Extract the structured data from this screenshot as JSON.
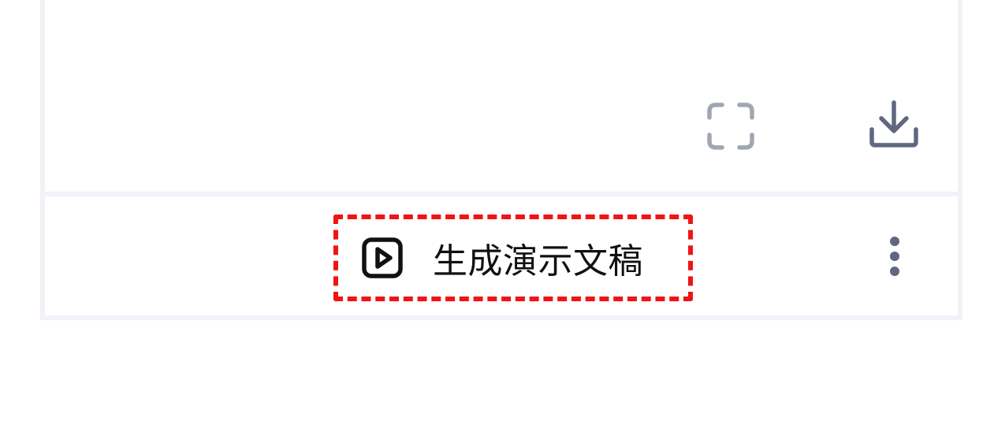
{
  "toolbar": {
    "fullscreen_icon": "fullscreen-icon",
    "download_icon": "download-icon"
  },
  "actions": {
    "generate_label": "生成演示文稿",
    "generate_icon": "play-square-icon",
    "more_icon": "more-vertical-icon"
  },
  "colors": {
    "frame": "#f1f2f7",
    "fullscreen_icon": "#a0a6b4",
    "download_icon": "#5f6880",
    "more_icon": "#5f6880",
    "highlight_dash": "#f01414",
    "label_text": "#111111"
  }
}
